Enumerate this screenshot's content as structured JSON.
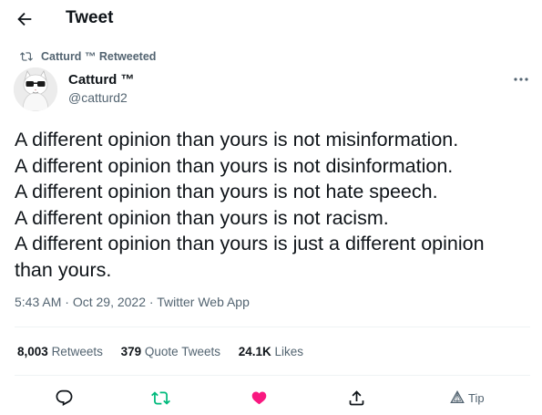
{
  "header": {
    "title": "Tweet"
  },
  "retweet_context": {
    "text": "Catturd ™ Retweeted"
  },
  "author": {
    "name": "Catturd ™",
    "handle": "@catturd2"
  },
  "tweet": {
    "lines": [
      "A different opinion than yours is not misinformation.",
      "A different opinion than yours is not disinformation.",
      "A different opinion than yours is not hate speech.",
      "A different opinion than yours is not racism.",
      "A different opinion than yours is just a different opinion",
      "than yours."
    ]
  },
  "meta": {
    "time": "5:43 AM",
    "separator1": " · ",
    "date": "Oct 29, 2022",
    "separator2": " · ",
    "source": "Twitter Web App"
  },
  "stats": {
    "retweets_count": "8,003",
    "retweets_label": "Retweets",
    "quotes_count": "379",
    "quotes_label": "Quote Tweets",
    "likes_count": "24.1K",
    "likes_label": "Likes"
  },
  "actions": {
    "tip_label": "Tip"
  },
  "colors": {
    "text_primary": "#0f1419",
    "text_secondary": "#536471",
    "retweet_green": "#00ba7c",
    "like_pink": "#f91880",
    "divider": "#eff3f4"
  },
  "icons": {
    "back": "arrow-left-icon",
    "retweet_context": "retweet-icon",
    "more": "more-dots-icon",
    "reply": "reply-bubble-icon",
    "retweet": "retweet-icon",
    "like": "heart-icon",
    "share": "share-upload-icon",
    "tip": "tip-icon"
  }
}
